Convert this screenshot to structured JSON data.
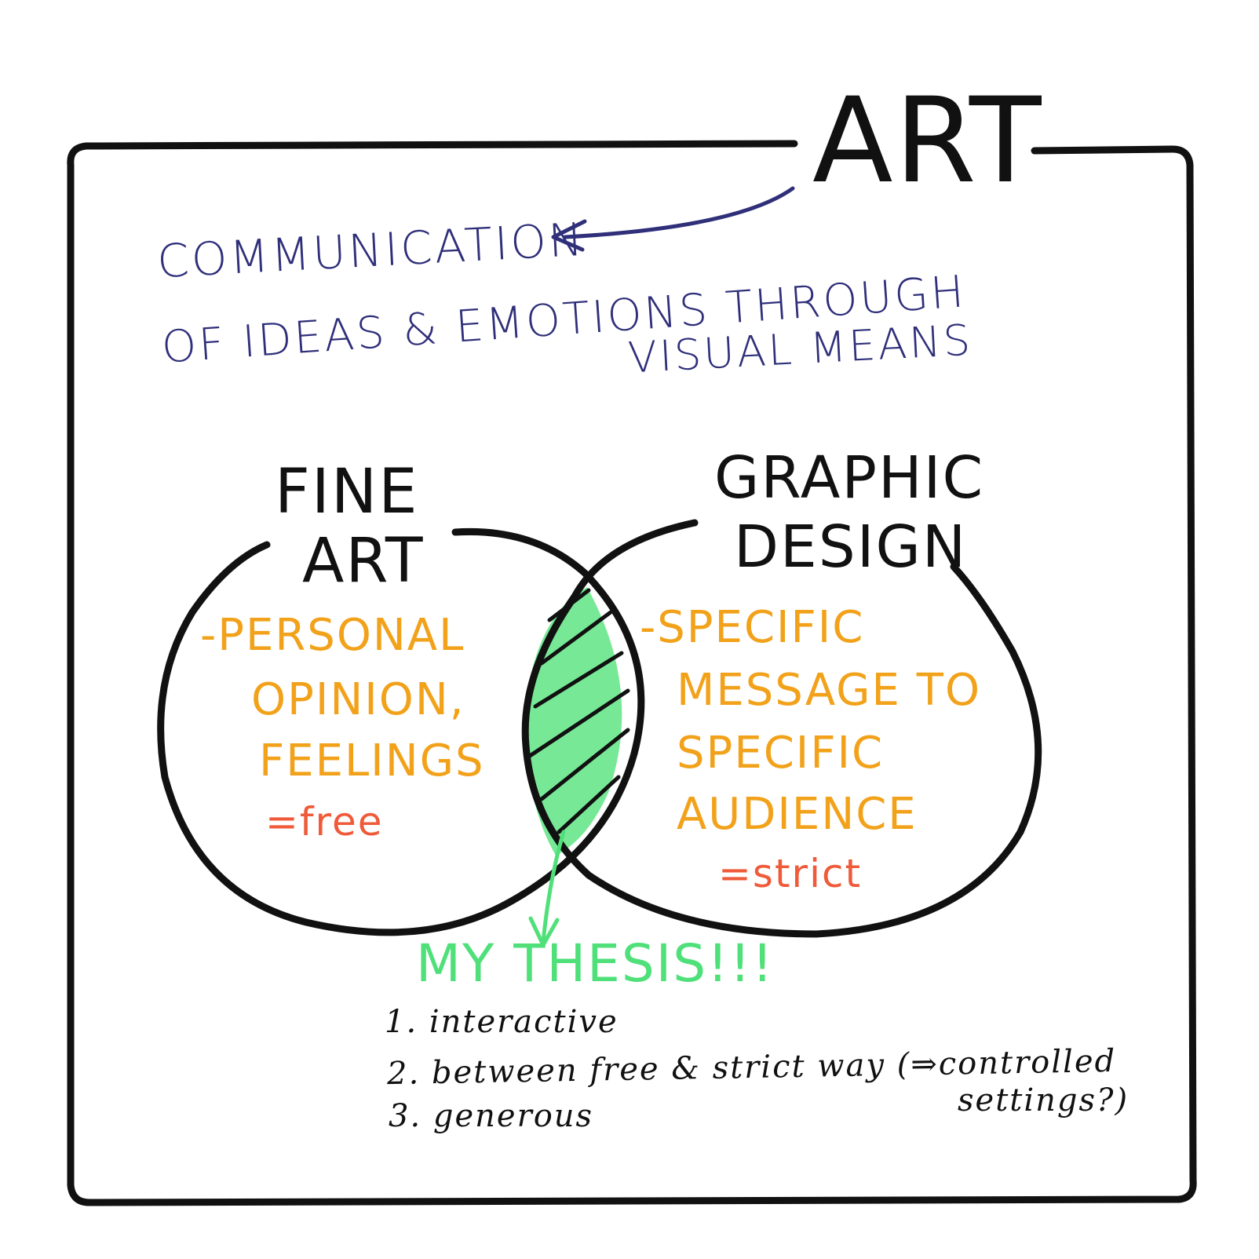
{
  "title": "ART",
  "definition": {
    "line1": "COMMUNICATION",
    "line2": "OF IDEAS & EMOTIONS THROUGH",
    "line3": "VISUAL MEANS"
  },
  "left_set": {
    "heading_line1": "FINE",
    "heading_line2": "ART",
    "points": [
      "-PERSONAL",
      "OPINION,",
      "FEELINGS"
    ],
    "summary": "=free"
  },
  "right_set": {
    "heading_line1": "GRAPHIC",
    "heading_line2": "DESIGN",
    "points": [
      "-SPECIFIC",
      "MESSAGE TO",
      "SPECIFIC",
      "AUDIENCE"
    ],
    "summary": "=strict"
  },
  "intersection": {
    "label": "MY THESIS!!!",
    "notes": [
      "1. interactive",
      "2. between free & strict way (⇒controlled",
      "settings?)",
      "3. generous"
    ]
  },
  "colors": {
    "ink": "#111111",
    "definition": "#2f2f7a",
    "points": "#f2a21a",
    "summary": "#ef5b3a",
    "thesis": "#4fe07a"
  }
}
